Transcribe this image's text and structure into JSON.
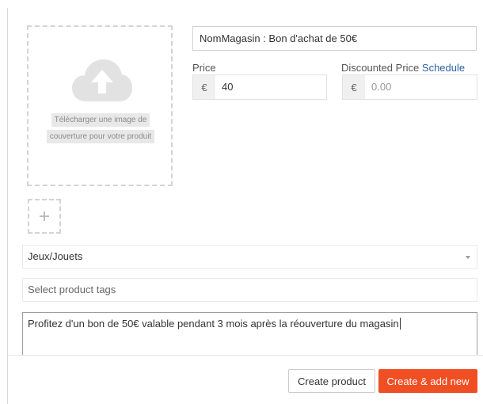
{
  "image_upload": {
    "icon": "cloud-upload-icon",
    "line1": "Télécharger une image de",
    "line2": "couverture pour votre produit"
  },
  "gallery": {
    "add_icon": "plus-icon"
  },
  "product": {
    "title_value": "NomMagasin : Bon d'achat de 50€",
    "price_label": "Price",
    "price_currency": "€",
    "price_value": "40",
    "discount_label": "Discounted Price",
    "schedule_label": "Schedule",
    "discount_currency": "€",
    "discount_placeholder": "0.00"
  },
  "category": {
    "selected": "Jeux/Jouets"
  },
  "tags": {
    "placeholder": "Select product tags"
  },
  "description": {
    "value": "Profitez d'un bon de 50€ valable pendant 3 mois après la réouverture du magasin"
  },
  "footer": {
    "create_label": "Create product",
    "create_add_label": "Create & add new"
  },
  "colors": {
    "primary_button": "#f04e23",
    "link": "#2b5fa5"
  }
}
